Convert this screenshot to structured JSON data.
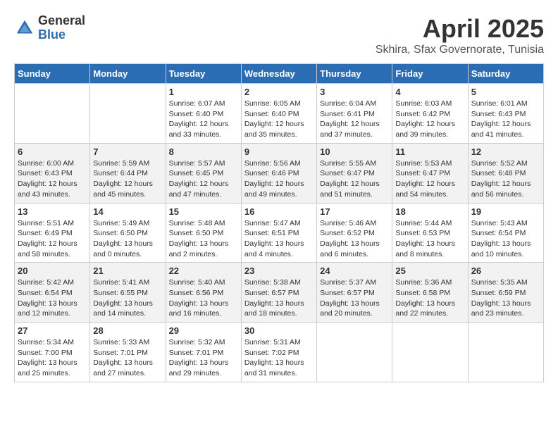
{
  "logo": {
    "general": "General",
    "blue": "Blue"
  },
  "title": "April 2025",
  "subtitle": "Skhira, Sfax Governorate, Tunisia",
  "days_of_week": [
    "Sunday",
    "Monday",
    "Tuesday",
    "Wednesday",
    "Thursday",
    "Friday",
    "Saturday"
  ],
  "weeks": [
    [
      {
        "day": "",
        "info": ""
      },
      {
        "day": "",
        "info": ""
      },
      {
        "day": "1",
        "info": "Sunrise: 6:07 AM\nSunset: 6:40 PM\nDaylight: 12 hours and 33 minutes."
      },
      {
        "day": "2",
        "info": "Sunrise: 6:05 AM\nSunset: 6:40 PM\nDaylight: 12 hours and 35 minutes."
      },
      {
        "day": "3",
        "info": "Sunrise: 6:04 AM\nSunset: 6:41 PM\nDaylight: 12 hours and 37 minutes."
      },
      {
        "day": "4",
        "info": "Sunrise: 6:03 AM\nSunset: 6:42 PM\nDaylight: 12 hours and 39 minutes."
      },
      {
        "day": "5",
        "info": "Sunrise: 6:01 AM\nSunset: 6:43 PM\nDaylight: 12 hours and 41 minutes."
      }
    ],
    [
      {
        "day": "6",
        "info": "Sunrise: 6:00 AM\nSunset: 6:43 PM\nDaylight: 12 hours and 43 minutes."
      },
      {
        "day": "7",
        "info": "Sunrise: 5:59 AM\nSunset: 6:44 PM\nDaylight: 12 hours and 45 minutes."
      },
      {
        "day": "8",
        "info": "Sunrise: 5:57 AM\nSunset: 6:45 PM\nDaylight: 12 hours and 47 minutes."
      },
      {
        "day": "9",
        "info": "Sunrise: 5:56 AM\nSunset: 6:46 PM\nDaylight: 12 hours and 49 minutes."
      },
      {
        "day": "10",
        "info": "Sunrise: 5:55 AM\nSunset: 6:47 PM\nDaylight: 12 hours and 51 minutes."
      },
      {
        "day": "11",
        "info": "Sunrise: 5:53 AM\nSunset: 6:47 PM\nDaylight: 12 hours and 54 minutes."
      },
      {
        "day": "12",
        "info": "Sunrise: 5:52 AM\nSunset: 6:48 PM\nDaylight: 12 hours and 56 minutes."
      }
    ],
    [
      {
        "day": "13",
        "info": "Sunrise: 5:51 AM\nSunset: 6:49 PM\nDaylight: 12 hours and 58 minutes."
      },
      {
        "day": "14",
        "info": "Sunrise: 5:49 AM\nSunset: 6:50 PM\nDaylight: 13 hours and 0 minutes."
      },
      {
        "day": "15",
        "info": "Sunrise: 5:48 AM\nSunset: 6:50 PM\nDaylight: 13 hours and 2 minutes."
      },
      {
        "day": "16",
        "info": "Sunrise: 5:47 AM\nSunset: 6:51 PM\nDaylight: 13 hours and 4 minutes."
      },
      {
        "day": "17",
        "info": "Sunrise: 5:46 AM\nSunset: 6:52 PM\nDaylight: 13 hours and 6 minutes."
      },
      {
        "day": "18",
        "info": "Sunrise: 5:44 AM\nSunset: 6:53 PM\nDaylight: 13 hours and 8 minutes."
      },
      {
        "day": "19",
        "info": "Sunrise: 5:43 AM\nSunset: 6:54 PM\nDaylight: 13 hours and 10 minutes."
      }
    ],
    [
      {
        "day": "20",
        "info": "Sunrise: 5:42 AM\nSunset: 6:54 PM\nDaylight: 13 hours and 12 minutes."
      },
      {
        "day": "21",
        "info": "Sunrise: 5:41 AM\nSunset: 6:55 PM\nDaylight: 13 hours and 14 minutes."
      },
      {
        "day": "22",
        "info": "Sunrise: 5:40 AM\nSunset: 6:56 PM\nDaylight: 13 hours and 16 minutes."
      },
      {
        "day": "23",
        "info": "Sunrise: 5:38 AM\nSunset: 6:57 PM\nDaylight: 13 hours and 18 minutes."
      },
      {
        "day": "24",
        "info": "Sunrise: 5:37 AM\nSunset: 6:57 PM\nDaylight: 13 hours and 20 minutes."
      },
      {
        "day": "25",
        "info": "Sunrise: 5:36 AM\nSunset: 6:58 PM\nDaylight: 13 hours and 22 minutes."
      },
      {
        "day": "26",
        "info": "Sunrise: 5:35 AM\nSunset: 6:59 PM\nDaylight: 13 hours and 23 minutes."
      }
    ],
    [
      {
        "day": "27",
        "info": "Sunrise: 5:34 AM\nSunset: 7:00 PM\nDaylight: 13 hours and 25 minutes."
      },
      {
        "day": "28",
        "info": "Sunrise: 5:33 AM\nSunset: 7:01 PM\nDaylight: 13 hours and 27 minutes."
      },
      {
        "day": "29",
        "info": "Sunrise: 5:32 AM\nSunset: 7:01 PM\nDaylight: 13 hours and 29 minutes."
      },
      {
        "day": "30",
        "info": "Sunrise: 5:31 AM\nSunset: 7:02 PM\nDaylight: 13 hours and 31 minutes."
      },
      {
        "day": "",
        "info": ""
      },
      {
        "day": "",
        "info": ""
      },
      {
        "day": "",
        "info": ""
      }
    ]
  ]
}
